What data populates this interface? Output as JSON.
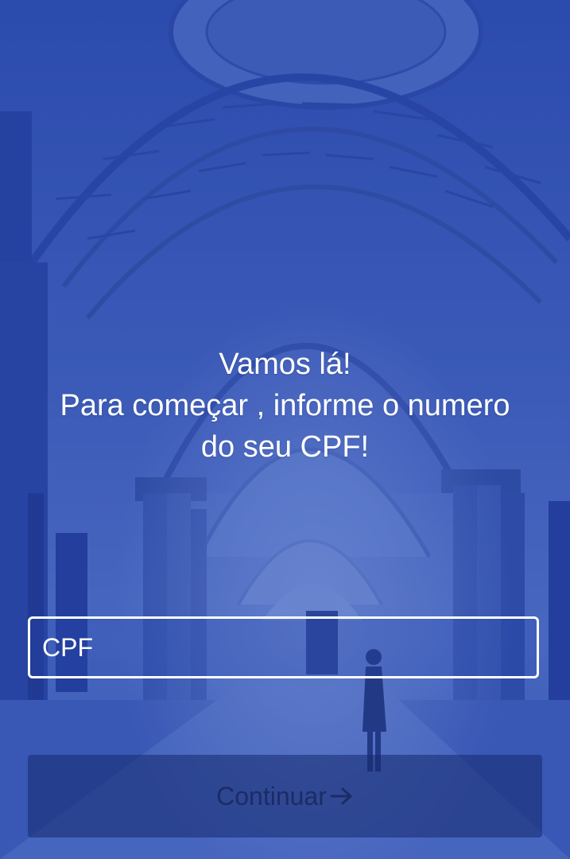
{
  "colors": {
    "background": "#2d4aa8",
    "text": "#ffffff",
    "button_text": "#1b2c66"
  },
  "headline": {
    "line1": "Vamos lá!",
    "line2": "Para começar , informe o numero",
    "line3": "do seu CPF!"
  },
  "cpf_input": {
    "placeholder": "CPF",
    "value": ""
  },
  "continue_button": {
    "label": "Continuar",
    "icon": "arrow-right-icon"
  }
}
